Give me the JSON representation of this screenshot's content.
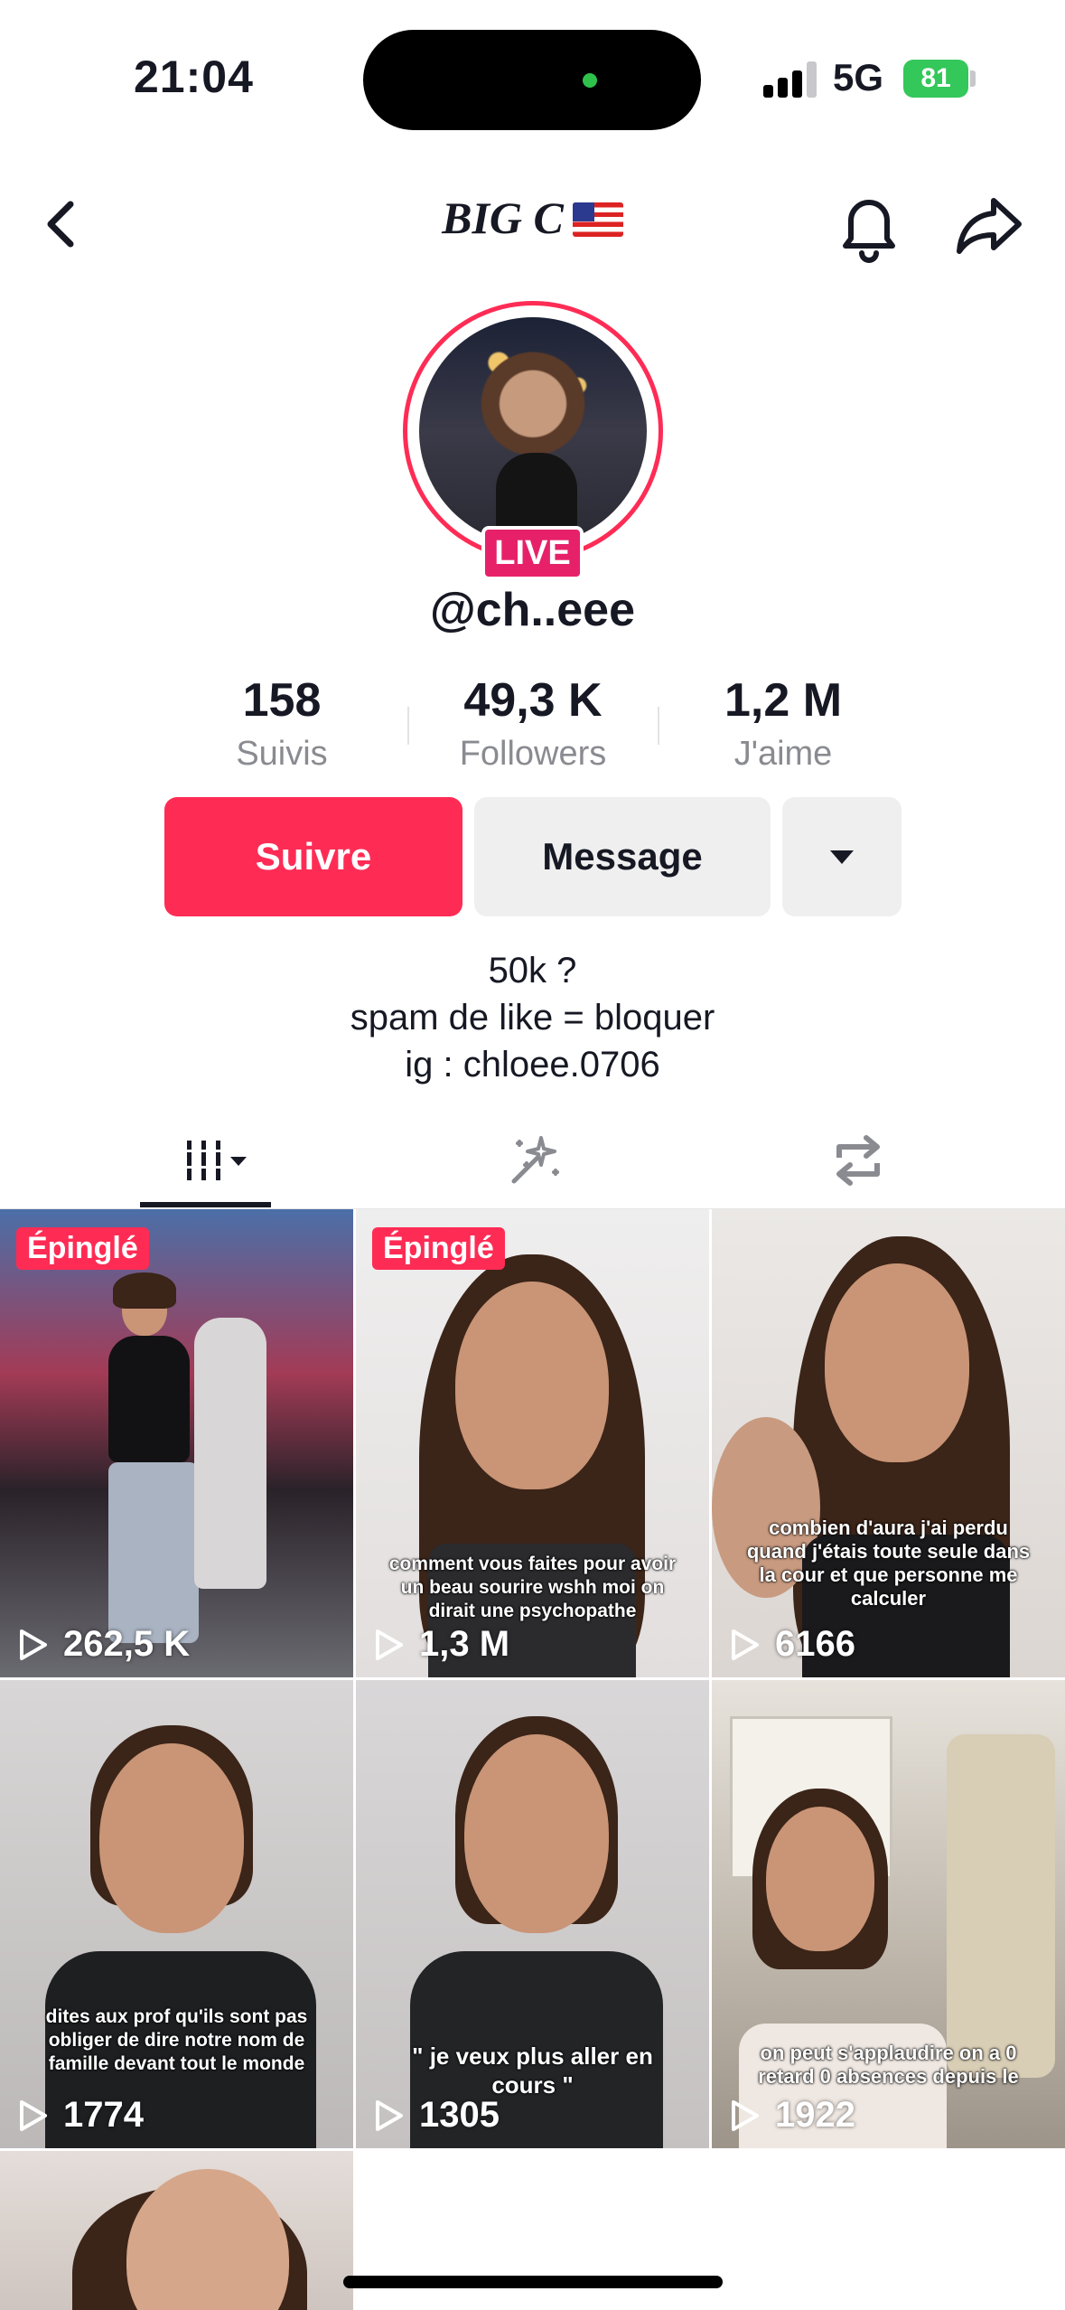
{
  "status_bar": {
    "time": "21:04",
    "network": "5G",
    "battery": "81"
  },
  "header": {
    "title": "BIG C"
  },
  "profile": {
    "live_label": "LIVE",
    "username": "@ch..eee",
    "stats": [
      {
        "value": "158",
        "label": "Suivis"
      },
      {
        "value": "49,3 K",
        "label": "Followers"
      },
      {
        "value": "1,2 M",
        "label": "J'aime"
      }
    ],
    "buttons": {
      "follow": "Suivre",
      "message": "Message"
    },
    "bio": [
      "50k ?",
      "spam de like = bloquer",
      "ig : chloee.0706"
    ]
  },
  "tabs": [
    {
      "name": "videos",
      "icon": "grid-icon",
      "active": true
    },
    {
      "name": "favorites",
      "icon": "sparkle-icon",
      "active": false
    },
    {
      "name": "reposts",
      "icon": "repost-icon",
      "active": false
    }
  ],
  "videos": [
    {
      "pinned": "Épinglé",
      "plays": "262,5 K",
      "caption": ""
    },
    {
      "pinned": "Épinglé",
      "plays": "1,3 M",
      "caption": "comment vous faites pour avoir un beau sourire wshh moi on dirait une psychopathe"
    },
    {
      "pinned": "",
      "plays": "6166",
      "caption": "combien d'aura j'ai perdu quand j'étais toute seule dans la cour et que personne me calculer"
    },
    {
      "pinned": "",
      "plays": "1774",
      "caption": "dites aux prof qu'ils sont pas obliger de dire notre nom de famille devant tout le monde"
    },
    {
      "pinned": "",
      "plays": "1305",
      "caption": "\" je veux plus aller en cours \""
    },
    {
      "pinned": "",
      "plays": "1922",
      "caption": "on peut s'applaudire on a 0 retard 0 absences depuis le"
    }
  ],
  "colors": {
    "accent": "#fe2c55",
    "live": "#e6216a",
    "battery": "#34c759"
  }
}
